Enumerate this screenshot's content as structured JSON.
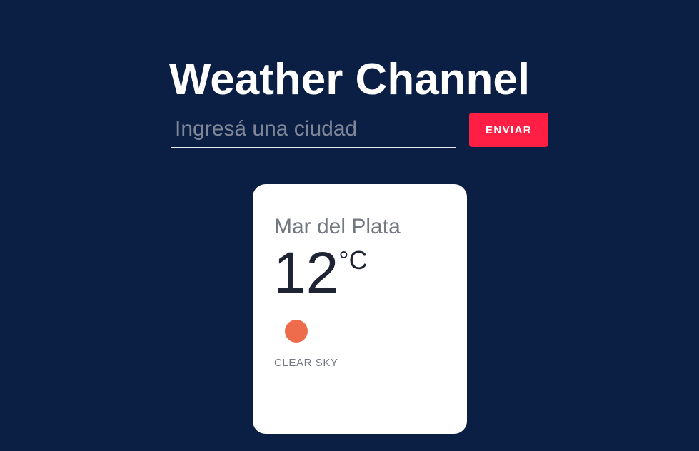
{
  "header": {
    "title": "Weather Channel"
  },
  "search": {
    "value": "",
    "placeholder": "Ingresá una ciudad",
    "button_label": "ENVIAR"
  },
  "weather": {
    "city": "Mar del Plata",
    "temperature": "12",
    "unit": "°C",
    "icon": "sun-icon",
    "description": "CLEAR SKY"
  },
  "colors": {
    "background": "#0b1f45",
    "accent": "#ff1f45",
    "card_background": "#ffffff",
    "sun": "#ee6b4c"
  }
}
